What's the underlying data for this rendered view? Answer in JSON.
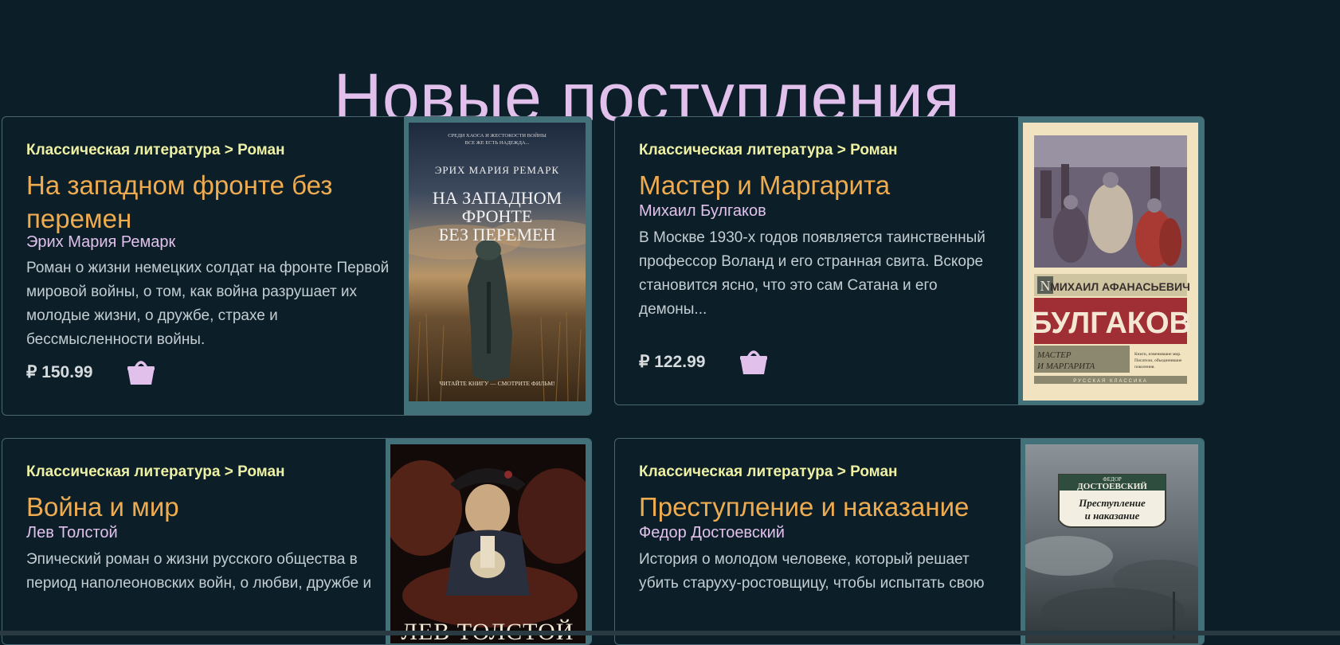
{
  "page": {
    "title": "Новые поступления"
  },
  "books": [
    {
      "category": "Классическая литература > Роман",
      "title": "На западном фронте без перемен",
      "author": "Эрих Мария Ремарк",
      "description": "Роман о жизни немецких солдат на фронте Первой мировой войны, о том, как война разрушает их молодые жизни, о дружбе, страхе и бессмысленности войны.",
      "price": "₽ 150.99",
      "cart_icon": "shopping-basket-icon",
      "cover": {
        "top_text": "СРЕДИ ХАОСА И ЖЕСТОКОСТИ ВОЙНЫ",
        "top_text2": "ВСЕ ЖЕ ЕСТЬ НАДЕЖДА...",
        "author": "ЭРИХ МАРИЯ РЕМАРК",
        "title_line1": "НА ЗАПАДНОМ",
        "title_line2": "ФРОНТЕ",
        "title_line3": "БЕЗ ПЕРЕМЕН",
        "bottom_text": "ЧИТАЙТЕ КНИГУ — СМОТРИТЕ ФИЛЬМ!"
      }
    },
    {
      "category": "Классическая литература > Роман",
      "title": "Мастер и Маргарита",
      "author": "Михаил Булгаков",
      "description": "В Москве 1930-х годов появляется таинственный профессор Воланд и его странная свита. Вскоре становится ясно, что это сам Сатана и его демоны...",
      "price": "₽ 122.99",
      "cart_icon": "shopping-basket-icon",
      "cover": {
        "logo": "N",
        "author_full": "МИХАИЛ АФАНАСЬЕВИЧ",
        "surname": "БУЛГАКОВ",
        "title_line1": "МАСТЕР",
        "title_line2": "И МАРГАРИТА",
        "blurb_line1": "Книги, изменившие мир.",
        "blurb_line2": "Писатели, объединившие",
        "blurb_line3": "поколения.",
        "series": "РУССКАЯ КЛАССИКА"
      }
    },
    {
      "category": "Классическая литература > Роман",
      "title": "Война и мир",
      "author": "Лев Толстой",
      "description": "Эпический роман о жизни русского общества в период наполеоновских войн, о любви, дружбе и",
      "cover": {
        "author": "ЛЕВ ТОЛСТОЙ"
      }
    },
    {
      "category": "Классическая литература > Роман",
      "title": "Преступление и наказание",
      "author": "Федор Достоевский",
      "description": "История о молодом человеке, который решает убить старуху-ростовщицу, чтобы испытать свою",
      "cover": {
        "author_small": "ФЕДОР",
        "author": "ДОСТОЕВСКИЙ",
        "title_line1": "Преступление",
        "title_line2": "и наказание"
      }
    }
  ],
  "colors": {
    "background": "#0c1f29",
    "heading": "#e1c1ec",
    "category": "#eef0a3",
    "book_title": "#eeab4f",
    "author": "#e1c1ec",
    "frame": "#43717a"
  }
}
